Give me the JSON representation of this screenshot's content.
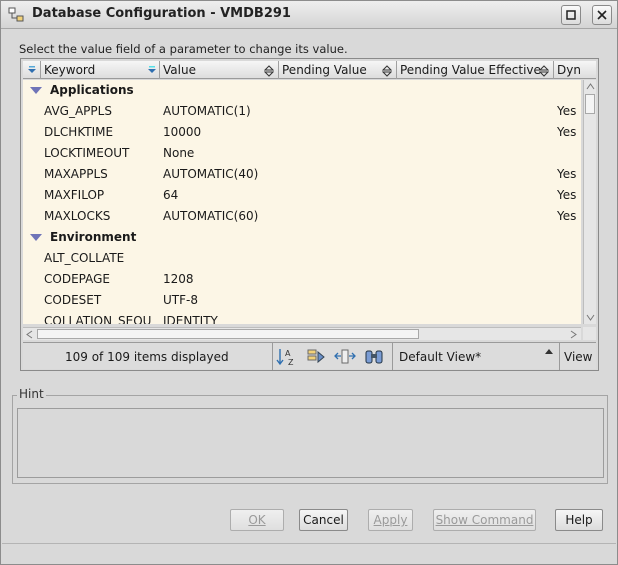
{
  "window": {
    "title": "Database Configuration - VMDB291"
  },
  "instruction": "Select the value field of a parameter to change its value.",
  "columns": [
    {
      "label": "Keyword"
    },
    {
      "label": "Value"
    },
    {
      "label": "Pending Value"
    },
    {
      "label": "Pending Value Effective"
    },
    {
      "label": "Dyn"
    }
  ],
  "rows": [
    {
      "type": "group",
      "label": "Applications"
    },
    {
      "type": "param",
      "keyword": "AVG_APPLS",
      "value": "AUTOMATIC(1)",
      "dyn": "Yes"
    },
    {
      "type": "param",
      "keyword": "DLCHKTIME",
      "value": "10000",
      "dyn": "Yes"
    },
    {
      "type": "param",
      "keyword": "LOCKTIMEOUT",
      "value": "None",
      "dyn": ""
    },
    {
      "type": "param",
      "keyword": "MAXAPPLS",
      "value": "AUTOMATIC(40)",
      "dyn": "Yes"
    },
    {
      "type": "param",
      "keyword": "MAXFILOP",
      "value": "64",
      "dyn": "Yes"
    },
    {
      "type": "param",
      "keyword": "MAXLOCKS",
      "value": "AUTOMATIC(60)",
      "dyn": "Yes"
    },
    {
      "type": "group",
      "label": "Environment"
    },
    {
      "type": "param",
      "keyword": "ALT_COLLATE",
      "value": "",
      "dyn": ""
    },
    {
      "type": "param",
      "keyword": "CODEPAGE",
      "value": "1208",
      "dyn": ""
    },
    {
      "type": "param",
      "keyword": "CODESET",
      "value": "UTF-8",
      "dyn": ""
    },
    {
      "type": "param",
      "keyword": "COLLATION_SEQU",
      "value": "IDENTITY",
      "dyn": ""
    }
  ],
  "status": {
    "items_displayed": "109 of 109 items displayed",
    "view_selected": "Default View*",
    "view_label": "View"
  },
  "hint": {
    "legend": "Hint",
    "text": ""
  },
  "buttons": {
    "ok": "OK",
    "cancel": "Cancel",
    "apply": "Apply",
    "show_command": "Show Command",
    "help": "Help"
  },
  "colors": {
    "table_background": "#fcf6e6",
    "group_triangle": "#6f74b8"
  },
  "icons": [
    "application-icon",
    "maximize-icon",
    "close-icon",
    "sort-icon",
    "sort-az-icon",
    "filter-icon",
    "customize-columns-icon",
    "binoculars-icon",
    "dropdown-arrow-icon"
  ]
}
